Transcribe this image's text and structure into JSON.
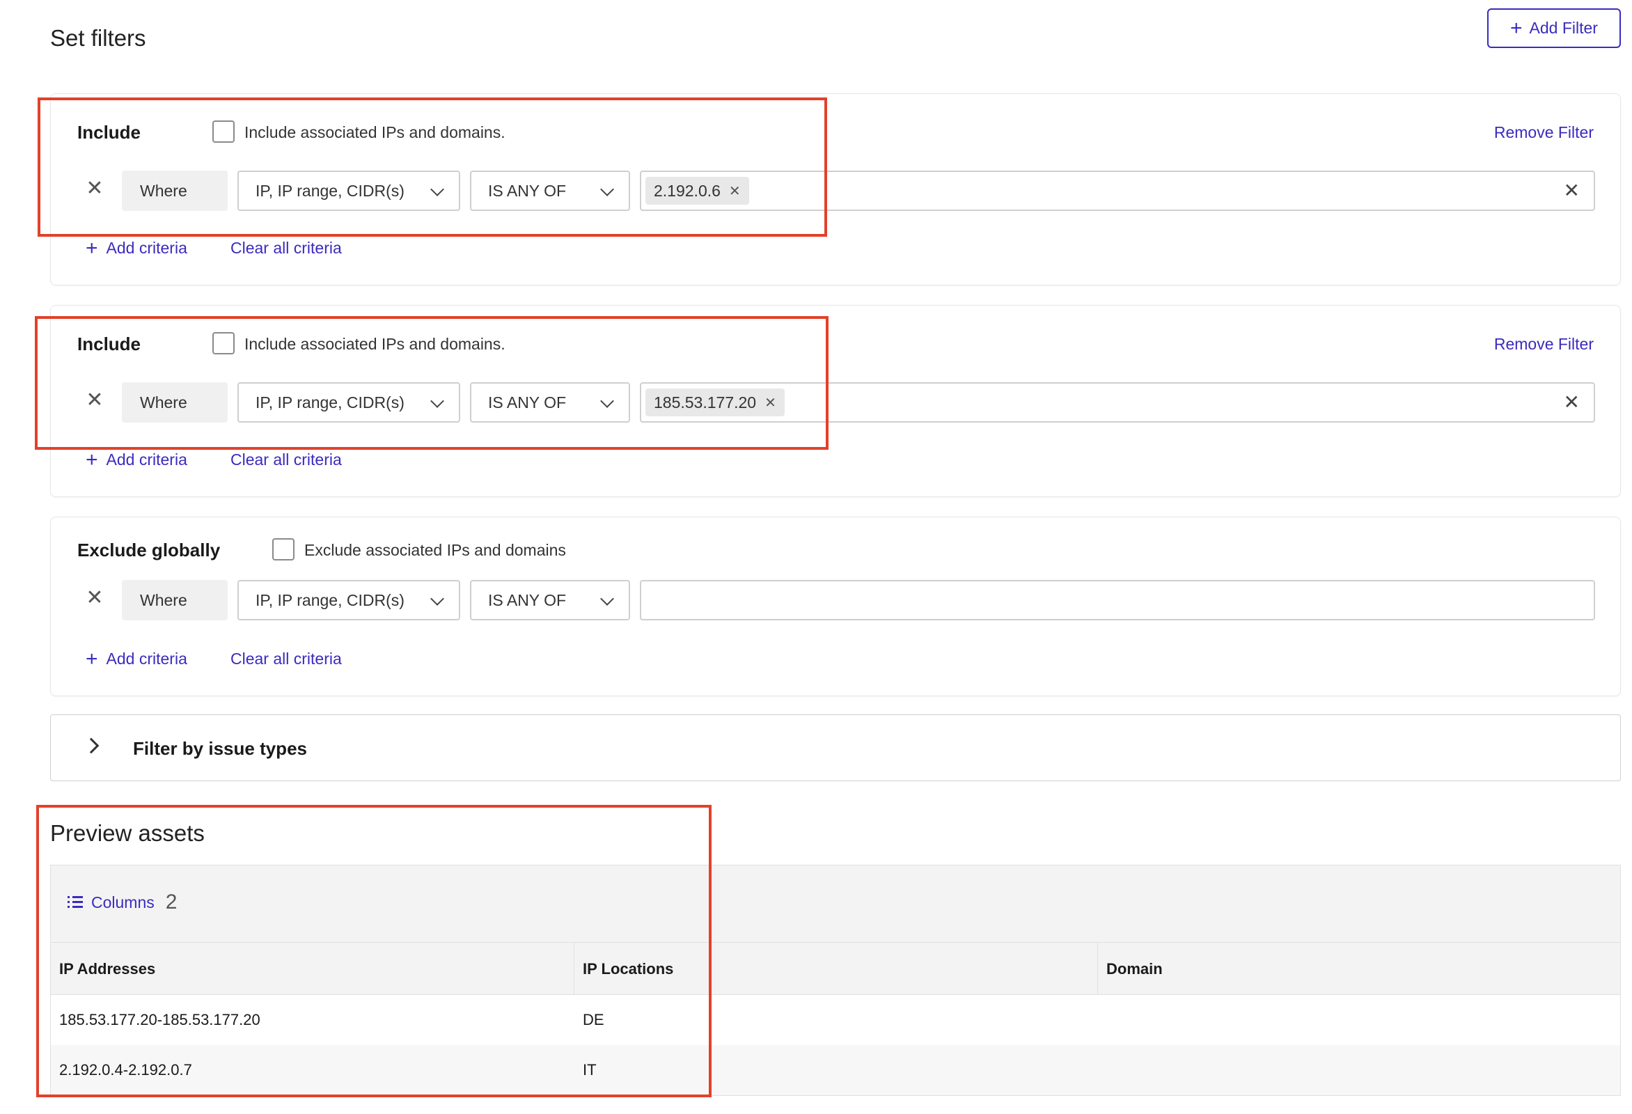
{
  "header": {
    "title": "Set filters",
    "add_filter_label": "Add Filter"
  },
  "filters": [
    {
      "label": "Include",
      "checkbox_label": "Include associated IPs and domains.",
      "remove_label": "Remove Filter",
      "where_label": "Where",
      "field": "IP, IP range, CIDR(s)",
      "operator": "IS ANY OF",
      "value": "2.192.0.6",
      "add_criteria": "Add criteria",
      "clear_criteria": "Clear all criteria"
    },
    {
      "label": "Include",
      "checkbox_label": "Include associated IPs and domains.",
      "remove_label": "Remove Filter",
      "where_label": "Where",
      "field": "IP, IP range, CIDR(s)",
      "operator": "IS ANY OF",
      "value": "185.53.177.20",
      "add_criteria": "Add criteria",
      "clear_criteria": "Clear all criteria"
    }
  ],
  "exclude": {
    "label": "Exclude globally",
    "checkbox_label": "Exclude associated IPs and domains",
    "where_label": "Where",
    "field": "IP, IP range, CIDR(s)",
    "operator": "IS ANY OF",
    "add_criteria": "Add criteria",
    "clear_criteria": "Clear all criteria"
  },
  "issue_types": {
    "title": "Filter by issue types"
  },
  "preview": {
    "title": "Preview assets",
    "columns_label": "Columns",
    "columns_count": "2",
    "headers": [
      "IP Addresses",
      "IP Locations",
      "Domain"
    ],
    "rows": [
      [
        "185.53.177.20-185.53.177.20",
        "DE",
        ""
      ],
      [
        "2.192.0.4-2.192.0.7",
        "IT",
        ""
      ]
    ]
  },
  "colors": {
    "accent": "#3b2bbf",
    "highlight": "#e2412b"
  },
  "icons": {
    "plus": "plus-icon",
    "close": "close-icon",
    "chevron_down": "chevron-down-icon",
    "chevron_right": "chevron-right-icon",
    "list": "list-icon"
  }
}
